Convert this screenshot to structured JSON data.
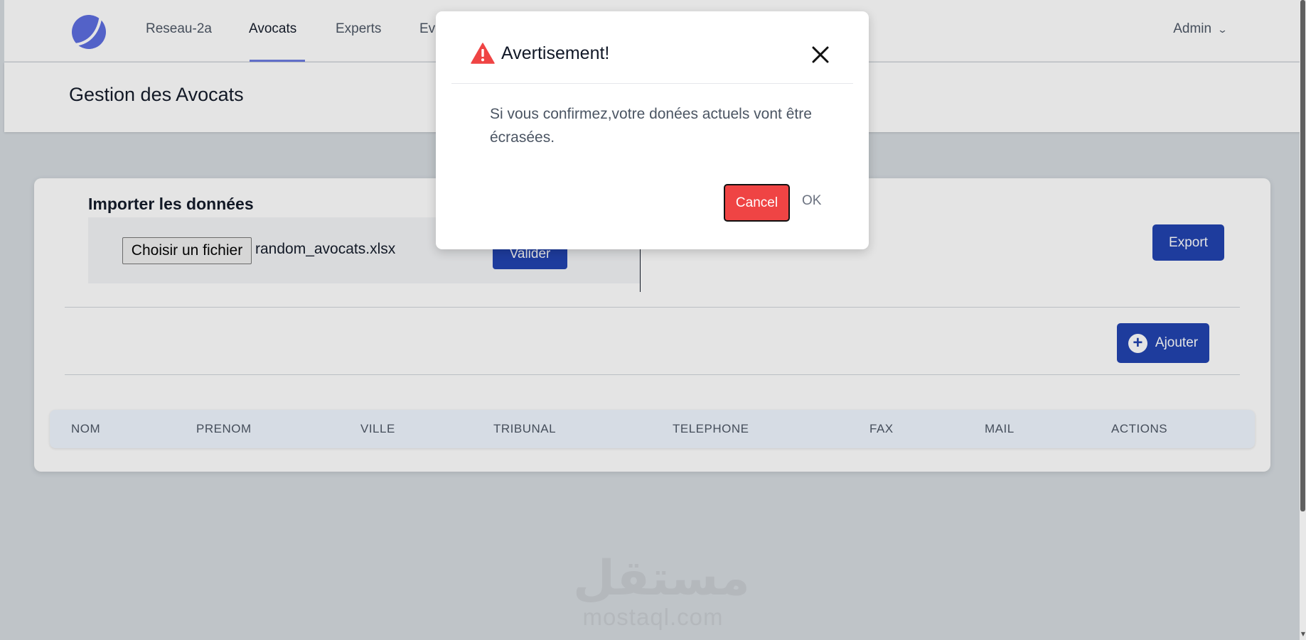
{
  "navbar": {
    "items": [
      {
        "label": "Reseau-2a",
        "active": false
      },
      {
        "label": "Avocats",
        "active": true
      },
      {
        "label": "Experts",
        "active": false
      },
      {
        "label": "Ev",
        "active": false
      }
    ],
    "admin_label": "Admin",
    "admin_chevron": "chevron-down-icon"
  },
  "header": {
    "title": "Gestion des Avocats"
  },
  "import": {
    "title": "Importer les données",
    "file_button_label": "Choisir un fichier",
    "file_name": "random_avocats.xlsx",
    "validate_label": "Valider"
  },
  "export": {
    "label": "Export"
  },
  "add": {
    "label": "Ajouter",
    "icon": "plus-circle-icon"
  },
  "table": {
    "columns": [
      "NOM",
      "PRENOM",
      "VILLE",
      "TRIBUNAL",
      "TELEPHONE",
      "FAX",
      "MAIL",
      "ACTIONS"
    ]
  },
  "watermark": {
    "arabic": "مستقل",
    "latin": "mostaql.com"
  },
  "modal": {
    "title": "Avertisement!",
    "icon": "warning-icon",
    "body": "Si vous confirmez,votre donées actuels vont être écrasées.",
    "cancel_label": "Cancel",
    "ok_label": "OK"
  },
  "colors": {
    "primary": "#1e40af",
    "danger": "#ef4444",
    "warning": "#ef4444",
    "nav_active_underline": "#6b7ae0"
  }
}
